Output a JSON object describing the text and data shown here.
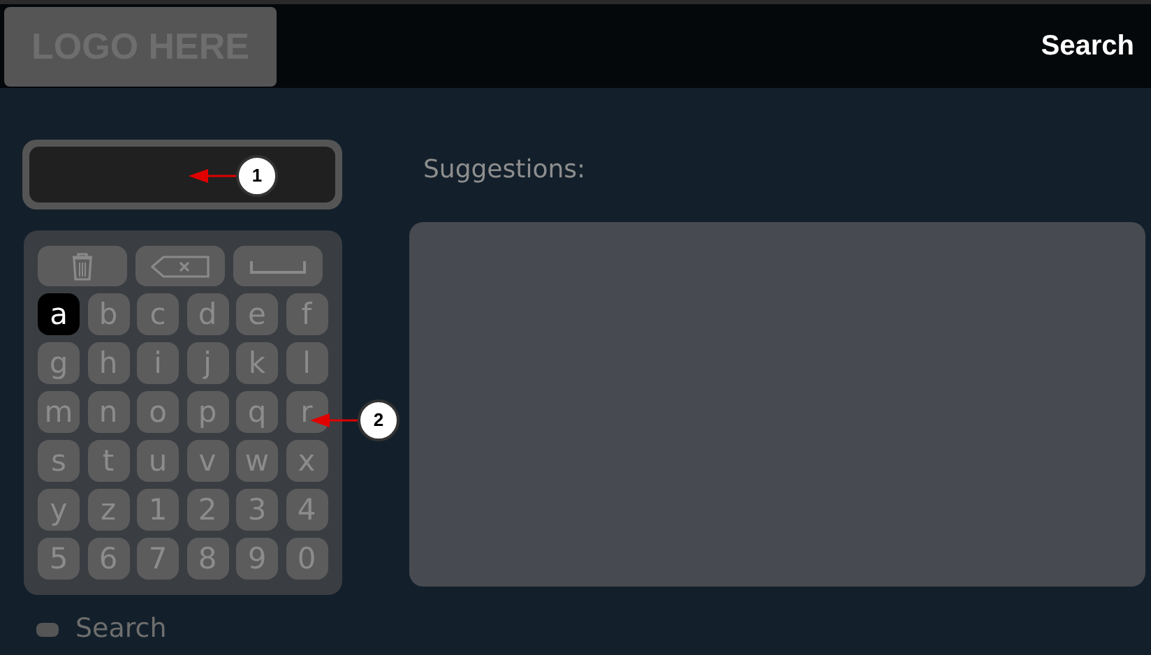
{
  "header": {
    "logo": "LOGO HERE",
    "title": "Search"
  },
  "keyboard": {
    "tool_keys": [
      {
        "kind": "delete"
      },
      {
        "kind": "backspace"
      },
      {
        "kind": "space"
      }
    ],
    "keys": [
      {
        "label": "a",
        "selected": true
      },
      {
        "label": "b",
        "selected": false
      },
      {
        "label": "c",
        "selected": false
      },
      {
        "label": "d",
        "selected": false
      },
      {
        "label": "e",
        "selected": false
      },
      {
        "label": "f",
        "selected": false
      },
      {
        "label": "g",
        "selected": false
      },
      {
        "label": "h",
        "selected": false
      },
      {
        "label": "i",
        "selected": false
      },
      {
        "label": "j",
        "selected": false
      },
      {
        "label": "k",
        "selected": false
      },
      {
        "label": "l",
        "selected": false
      },
      {
        "label": "m",
        "selected": false
      },
      {
        "label": "n",
        "selected": false
      },
      {
        "label": "o",
        "selected": false
      },
      {
        "label": "p",
        "selected": false
      },
      {
        "label": "q",
        "selected": false
      },
      {
        "label": "r",
        "selected": false
      },
      {
        "label": "s",
        "selected": false
      },
      {
        "label": "t",
        "selected": false
      },
      {
        "label": "u",
        "selected": false
      },
      {
        "label": "v",
        "selected": false
      },
      {
        "label": "w",
        "selected": false
      },
      {
        "label": "x",
        "selected": false
      },
      {
        "label": "y",
        "selected": false
      },
      {
        "label": "z",
        "selected": false
      },
      {
        "label": "1",
        "selected": false
      },
      {
        "label": "2",
        "selected": false
      },
      {
        "label": "3",
        "selected": false
      },
      {
        "label": "4",
        "selected": false
      },
      {
        "label": "5",
        "selected": false
      },
      {
        "label": "6",
        "selected": false
      },
      {
        "label": "7",
        "selected": false
      },
      {
        "label": "8",
        "selected": false
      },
      {
        "label": "9",
        "selected": false
      },
      {
        "label": "0",
        "selected": false
      }
    ]
  },
  "suggestions": {
    "heading": "Suggestions:"
  },
  "footer": {
    "label": "Search"
  },
  "callouts": [
    {
      "number": "1"
    },
    {
      "number": "2"
    }
  ]
}
